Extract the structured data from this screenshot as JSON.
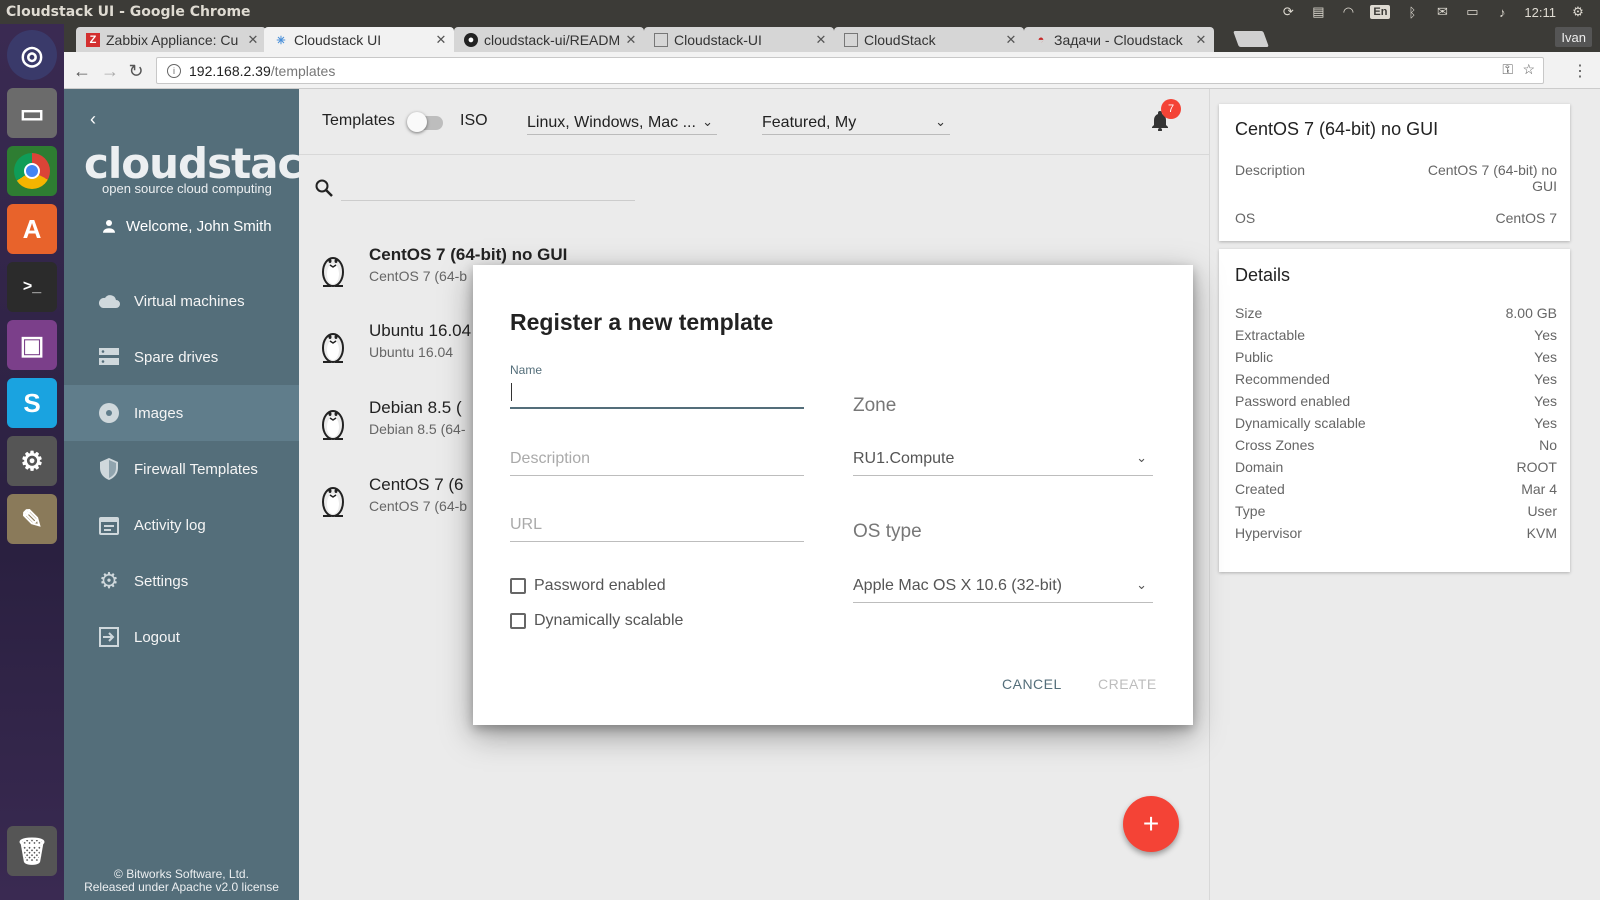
{
  "window": {
    "title": "Cloudstack UI - Google Chrome",
    "clock": "12:11",
    "lang": "En",
    "user": "Ivan"
  },
  "tabs": [
    {
      "label": "Zabbix Appliance: Cu",
      "icon": "zabbix-icon"
    },
    {
      "label": "Cloudstack UI",
      "icon": "cloudstack-icon"
    },
    {
      "label": "cloudstack-ui/READM",
      "icon": "github-icon"
    },
    {
      "label": "Cloudstack-UI",
      "icon": "page-icon"
    },
    {
      "label": "CloudStack",
      "icon": "page-icon"
    },
    {
      "label": "Задачи - Cloudstack",
      "icon": "redmine-icon"
    }
  ],
  "address": {
    "host": "192.168.2.39",
    "path": "/templates"
  },
  "sidebar": {
    "logo": "cloudstack",
    "tagline": "open source cloud computing",
    "welcome": "Welcome, John Smith",
    "items": [
      {
        "label": "Virtual machines",
        "icon": "cloud-icon"
      },
      {
        "label": "Spare drives",
        "icon": "storage-icon"
      },
      {
        "label": "Images",
        "icon": "disc-icon"
      },
      {
        "label": "Firewall Templates",
        "icon": "shield-icon"
      },
      {
        "label": "Activity log",
        "icon": "calendar-icon"
      },
      {
        "label": "Settings",
        "icon": "gear-icon"
      },
      {
        "label": "Logout",
        "icon": "logout-icon"
      }
    ],
    "active": "Images",
    "footer_line1": "© Bitworks Software, Ltd.",
    "footer_line2": "Released under Apache v2.0 license"
  },
  "filter": {
    "templates_label": "Templates",
    "iso_label": "ISO",
    "os_families": "Linux, Windows, Mac ...",
    "scope": "Featured, My",
    "notification_count": "7"
  },
  "templates": [
    {
      "name": "CentOS 7 (64-bit) no GUI",
      "desc": "CentOS 7 (64-b"
    },
    {
      "name": "Ubuntu 16.04",
      "desc": "Ubuntu 16.04"
    },
    {
      "name": "Debian 8.5 (",
      "desc": "Debian 8.5 (64-"
    },
    {
      "name": "CentOS 7 (6",
      "desc": "CentOS 7 (64-b"
    }
  ],
  "dialog": {
    "title": "Register a new template",
    "name_label": "Name",
    "description_placeholder": "Description",
    "url_placeholder": "URL",
    "zone_heading": "Zone",
    "zone_value": "RU1.Compute",
    "os_type_heading": "OS type",
    "os_type_value": "Apple Mac OS X 10.6 (32-bit)",
    "password_enabled": "Password enabled",
    "dynamically_scalable": "Dynamically scalable",
    "cancel": "CANCEL",
    "create": "CREATE"
  },
  "details": {
    "title": "CentOS 7 (64-bit) no GUI",
    "summary": [
      {
        "key": "Description",
        "value": "CentOS 7 (64-bit) no GUI"
      },
      {
        "key": "OS",
        "value": "CentOS 7"
      }
    ],
    "section_title": "Details",
    "rows": [
      {
        "key": "Size",
        "value": "8.00 GB"
      },
      {
        "key": "Extractable",
        "value": "Yes"
      },
      {
        "key": "Public",
        "value": "Yes"
      },
      {
        "key": "Recommended",
        "value": "Yes"
      },
      {
        "key": "Password enabled",
        "value": "Yes"
      },
      {
        "key": "Dynamically scalable",
        "value": "Yes"
      },
      {
        "key": "Cross Zones",
        "value": "No"
      },
      {
        "key": "Domain",
        "value": "ROOT"
      },
      {
        "key": "Created",
        "value": "Mar 4"
      },
      {
        "key": "Type",
        "value": "User"
      },
      {
        "key": "Hypervisor",
        "value": "KVM"
      }
    ]
  },
  "colors": {
    "sidebar": "#546e7a",
    "accent": "#f44336",
    "panel_bg": "#ebebeb"
  }
}
